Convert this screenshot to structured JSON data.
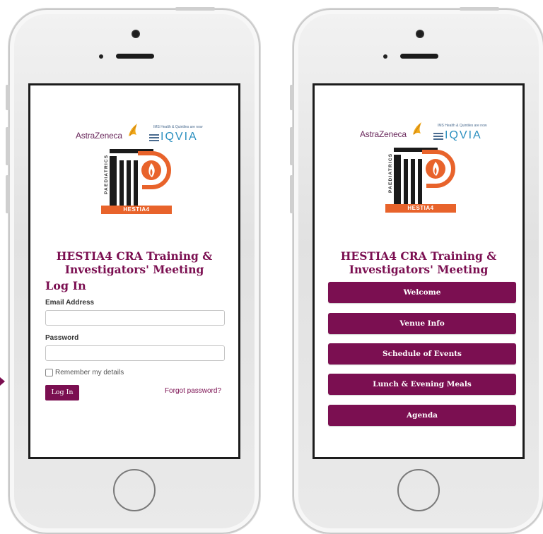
{
  "colors": {
    "accent": "#7b0f51",
    "orange": "#e8632b",
    "iqvia_blue": "#2a8fbf"
  },
  "logos": {
    "astrazeneca": "AstraZeneca",
    "iqvia_tagline": "IMS Health & Quintiles are now",
    "iqvia": "IQVIA",
    "paediatrics": "PAEDIATRICS",
    "hestia": "HESTIA4"
  },
  "meeting": {
    "title_line1": "HESTIA4 CRA Training &",
    "title_line2": "Investigators' Meeting"
  },
  "login": {
    "heading": "Log In",
    "email_label": "Email Address",
    "email_value": "",
    "password_label": "Password",
    "password_value": "",
    "remember_label": "Remember my details",
    "remember_checked": false,
    "submit_label": "Log In",
    "forgot_label": "Forgot password?"
  },
  "menu": {
    "items": [
      {
        "label": "Welcome"
      },
      {
        "label": "Venue Info"
      },
      {
        "label": "Schedule of Events"
      },
      {
        "label": "Lunch & Evening Meals"
      },
      {
        "label": "Agenda"
      }
    ]
  }
}
